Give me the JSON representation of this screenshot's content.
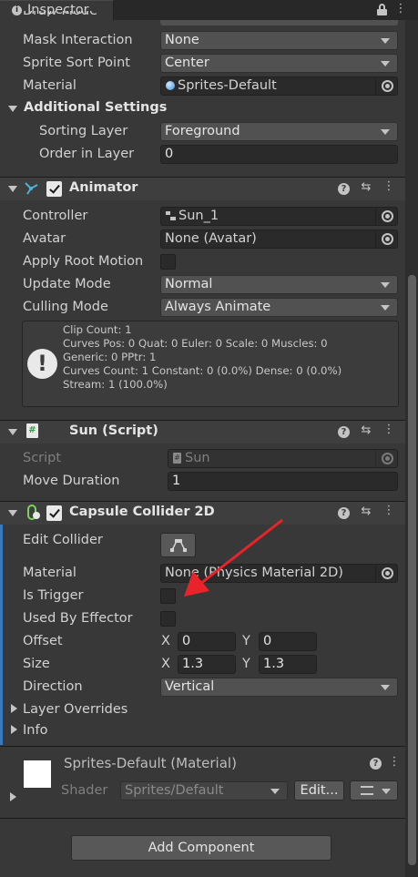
{
  "window": {
    "tab_label": "Inspector",
    "tab_icon": "i"
  },
  "top_fields": {
    "partial_label": "Draw Mode",
    "mask_interaction": {
      "label": "Mask Interaction",
      "value": "None"
    },
    "sprite_sort_point": {
      "label": "Sprite Sort Point",
      "value": "Center"
    },
    "material": {
      "label": "Material",
      "value": "Sprites-Default"
    },
    "additional_settings": "Additional Settings",
    "sorting_layer": {
      "label": "Sorting Layer",
      "value": "Foreground"
    },
    "order_in_layer": {
      "label": "Order in Layer",
      "value": "0"
    }
  },
  "animator": {
    "title": "Animator",
    "controller": {
      "label": "Controller",
      "value": "Sun_1"
    },
    "avatar": {
      "label": "Avatar",
      "value": "None (Avatar)"
    },
    "apply_root_motion": {
      "label": "Apply Root Motion",
      "checked": false
    },
    "update_mode": {
      "label": "Update Mode",
      "value": "Normal"
    },
    "culling_mode": {
      "label": "Culling Mode",
      "value": "Always Animate"
    },
    "info_lines": [
      "Clip Count: 1",
      "Curves Pos: 0 Quat: 0 Euler: 0 Scale: 0 Muscles: 0",
      "Generic: 0 PPtr: 1",
      "Curves Count: 1 Constant: 0 (0.0%) Dense: 0 (0.0%)",
      "Stream: 1 (100.0%)"
    ]
  },
  "script": {
    "title": "Sun (Script)",
    "script_field": {
      "label": "Script",
      "value": "Sun"
    },
    "move_duration": {
      "label": "Move Duration",
      "value": "1"
    }
  },
  "collider": {
    "title": "Capsule Collider 2D",
    "edit_collider": "Edit Collider",
    "material": {
      "label": "Material",
      "value": "None (Physics Material 2D)"
    },
    "is_trigger": {
      "label": "Is Trigger",
      "checked": false
    },
    "used_by_effector": {
      "label": "Used By Effector",
      "checked": false
    },
    "offset": {
      "label": "Offset",
      "x_label": "X",
      "x": "0",
      "y_label": "Y",
      "y": "0"
    },
    "size": {
      "label": "Size",
      "x_label": "X",
      "x": "1.3",
      "y_label": "Y",
      "y": "1.3"
    },
    "direction": {
      "label": "Direction",
      "value": "Vertical"
    },
    "layer_overrides": "Layer Overrides",
    "info": "Info"
  },
  "material_preview": {
    "title": "Sprites-Default (Material)",
    "shader_label": "Shader",
    "shader_value": "Sprites/Default",
    "edit_button": "Edit..."
  },
  "add_component": "Add Component",
  "colors": {
    "annotation_arrow": "#e8232a",
    "background": "#383838"
  }
}
